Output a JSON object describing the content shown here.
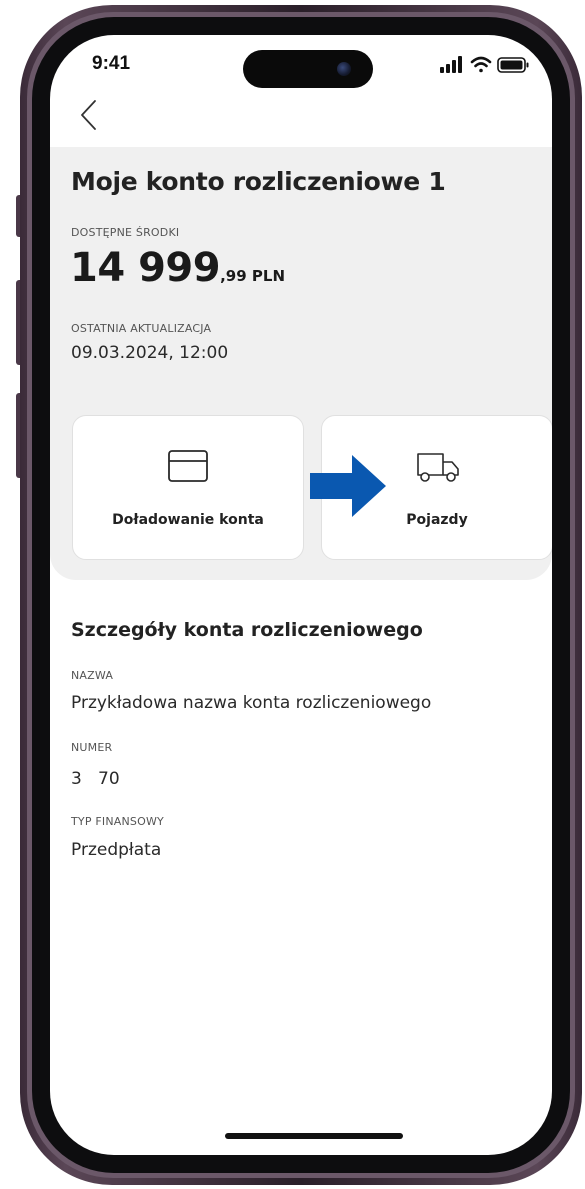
{
  "status": {
    "time": "9:41"
  },
  "account": {
    "title": "Moje konto rozliczeniowe 1",
    "available_label": "DOSTĘPNE ŚRODKI",
    "balance_main": "14 999",
    "balance_decimal": ",99 PLN",
    "updated_label": "OSTATNIA AKTUALIZACJA",
    "updated_value": "09.03.2024, 12:00"
  },
  "actions": {
    "topup_label": "Doładowanie konta",
    "vehicles_label": "Pojazdy"
  },
  "details": {
    "section_title": "Szczegóły konta rozliczeniowego",
    "name_label": "NAZWA",
    "name_value": "Przykładowa nazwa konta rozliczeniowego",
    "number_label": "NUMER",
    "number_value": "3   70",
    "type_label": "TYP FINANSOWY",
    "type_value": "Przedpłata"
  },
  "icons": {
    "back": "chevron-left-icon",
    "topup": "credit-card-icon",
    "vehicles": "truck-icon",
    "annotation": "arrow-right-icon"
  },
  "colors": {
    "annotation_arrow": "#0a58b0",
    "header_bg": "#f0f0f0"
  }
}
